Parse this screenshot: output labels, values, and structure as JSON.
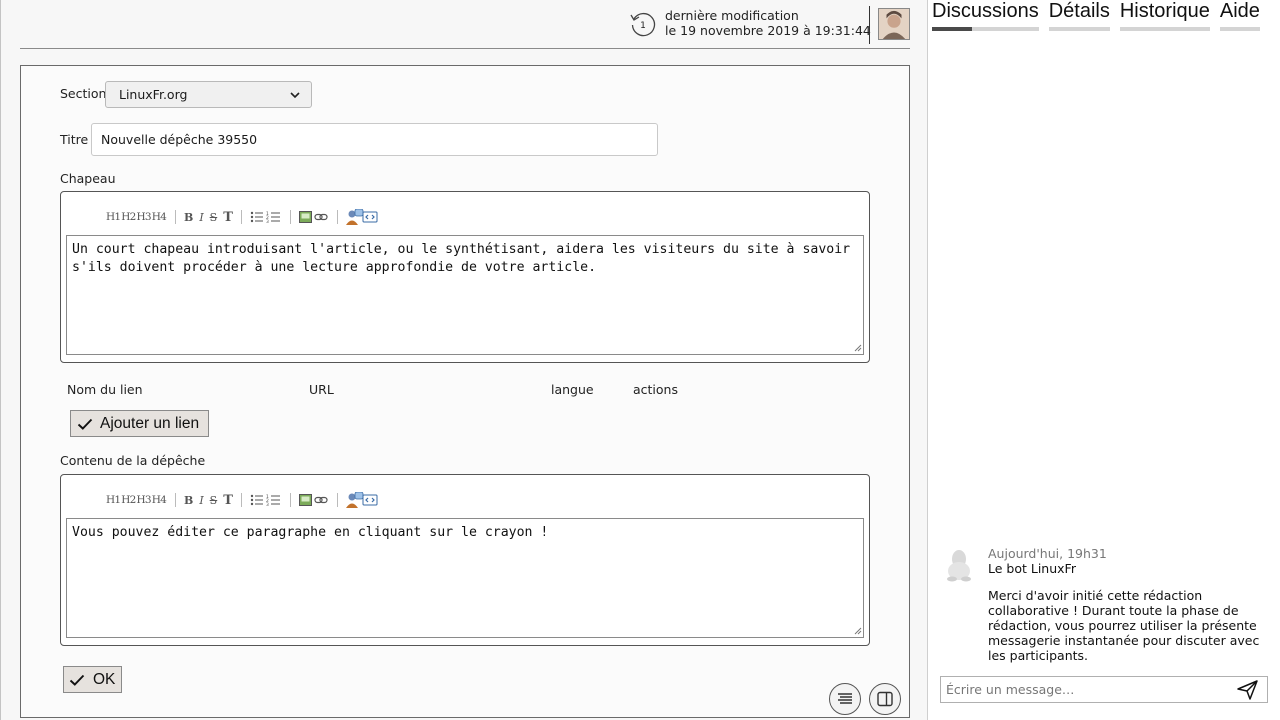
{
  "header": {
    "revision_count": "1",
    "last_modified_label": "dernière modification",
    "last_modified_date": "le 19 novembre 2019 à 19:31:44",
    "revision_icon": "history-icon",
    "avatar_icon": "user-avatar"
  },
  "form": {
    "section_label": "Section",
    "section_value": "LinuxFr.org",
    "title_label": "Titre",
    "title_value": "Nouvelle dépêche 39550",
    "intro_label": "Chapeau",
    "intro_text": "Un court chapeau introduisant l'article, ou le synthétisant, aidera les visiteurs du site à savoir s'ils doivent procéder à une lecture approfondie de votre article.",
    "links_columns": [
      "Nom du lien",
      "URL",
      "langue",
      "actions"
    ],
    "add_link_label": "Ajouter un lien",
    "content_label": "Contenu de la dépêche",
    "content_text": "Vous pouvez éditer ce paragraphe en cliquant sur le crayon !",
    "ok_label": "OK"
  },
  "toolbar": {
    "headings": [
      "H1",
      "H2",
      "H3",
      "H4"
    ],
    "format": [
      "B",
      "I",
      "S",
      "T"
    ],
    "icons": [
      "bulleted-list-icon",
      "numbered-list-icon",
      "image-icon",
      "link-icon",
      "user-help-icon",
      "code-icon"
    ]
  },
  "sidebar": {
    "tabs": [
      "Discussions",
      "Détails",
      "Historique",
      "Aide"
    ],
    "active_tab": "Discussions",
    "message": {
      "time": "Aujourd'hui, 19h31",
      "author": "Le bot LinuxFr",
      "text": "Merci d'avoir initié cette rédaction collaborative ! Durant toute la phase de rédaction, vous pourrez utiliser la présente messagerie instantanée pour discuter avec les participants."
    },
    "compose_placeholder": "Écrire un message…"
  },
  "colors": {
    "border": "#6a6a6a",
    "button_bg": "#e6e2de",
    "active_tab_marker": "#4a4a4a"
  }
}
